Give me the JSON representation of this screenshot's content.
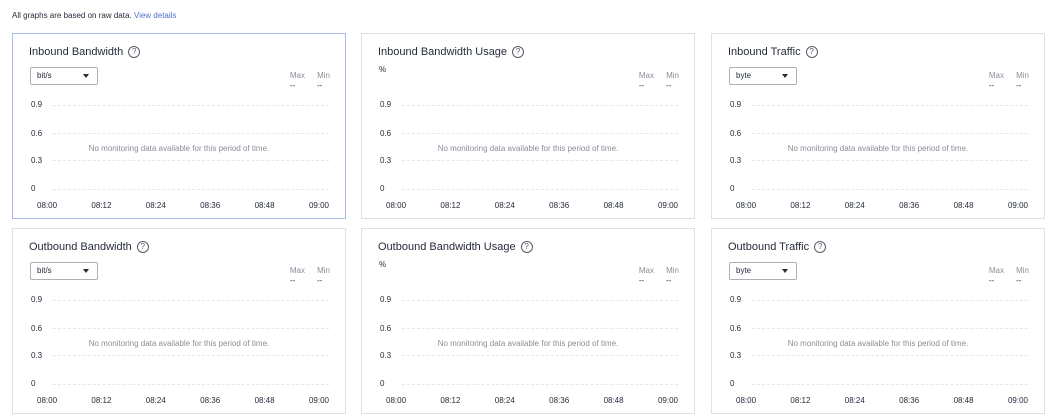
{
  "notice": {
    "text": "All graphs are based on raw data.",
    "link": "View details"
  },
  "empty_message": "No monitoring data available for this period of time.",
  "y_ticks": [
    "0.9",
    "0.6",
    "0.3",
    "0"
  ],
  "x_ticks": [
    "08:00",
    "08:12",
    "08:24",
    "08:36",
    "08:48",
    "09:00"
  ],
  "stats": {
    "max_label": "Max",
    "min_label": "Min",
    "max_value": "--",
    "min_value": "--"
  },
  "panels": [
    {
      "title": "Inbound Bandwidth",
      "unit": "bit/s",
      "unit_is_select": true,
      "active": true
    },
    {
      "title": "Inbound Bandwidth Usage",
      "unit": "%",
      "unit_is_select": false,
      "active": false
    },
    {
      "title": "Inbound Traffic",
      "unit": "byte",
      "unit_is_select": true,
      "active": false
    },
    {
      "title": "Outbound Bandwidth",
      "unit": "bit/s",
      "unit_is_select": true,
      "active": false
    },
    {
      "title": "Outbound Bandwidth Usage",
      "unit": "%",
      "unit_is_select": false,
      "active": false
    },
    {
      "title": "Outbound Traffic",
      "unit": "byte",
      "unit_is_select": true,
      "active": false
    }
  ],
  "chart_data": [
    {
      "type": "line",
      "title": "Inbound Bandwidth",
      "x": [
        "08:00",
        "08:12",
        "08:24",
        "08:36",
        "08:48",
        "09:00"
      ],
      "yticks": [
        0,
        0.3,
        0.6,
        0.9
      ],
      "series": []
    },
    {
      "type": "line",
      "title": "Inbound Bandwidth Usage",
      "x": [
        "08:00",
        "08:12",
        "08:24",
        "08:36",
        "08:48",
        "09:00"
      ],
      "yticks": [
        0,
        0.3,
        0.6,
        0.9
      ],
      "series": []
    },
    {
      "type": "line",
      "title": "Inbound Traffic",
      "x": [
        "08:00",
        "08:12",
        "08:24",
        "08:36",
        "08:48",
        "09:00"
      ],
      "yticks": [
        0,
        0.3,
        0.6,
        0.9
      ],
      "series": []
    },
    {
      "type": "line",
      "title": "Outbound Bandwidth",
      "x": [
        "08:00",
        "08:12",
        "08:24",
        "08:36",
        "08:48",
        "09:00"
      ],
      "yticks": [
        0,
        0.3,
        0.6,
        0.9
      ],
      "series": []
    },
    {
      "type": "line",
      "title": "Outbound Bandwidth Usage",
      "x": [
        "08:00",
        "08:12",
        "08:24",
        "08:36",
        "08:48",
        "09:00"
      ],
      "yticks": [
        0,
        0.3,
        0.6,
        0.9
      ],
      "series": []
    },
    {
      "type": "line",
      "title": "Outbound Traffic",
      "x": [
        "08:00",
        "08:12",
        "08:24",
        "08:36",
        "08:48",
        "09:00"
      ],
      "yticks": [
        0,
        0.3,
        0.6,
        0.9
      ],
      "series": []
    }
  ]
}
